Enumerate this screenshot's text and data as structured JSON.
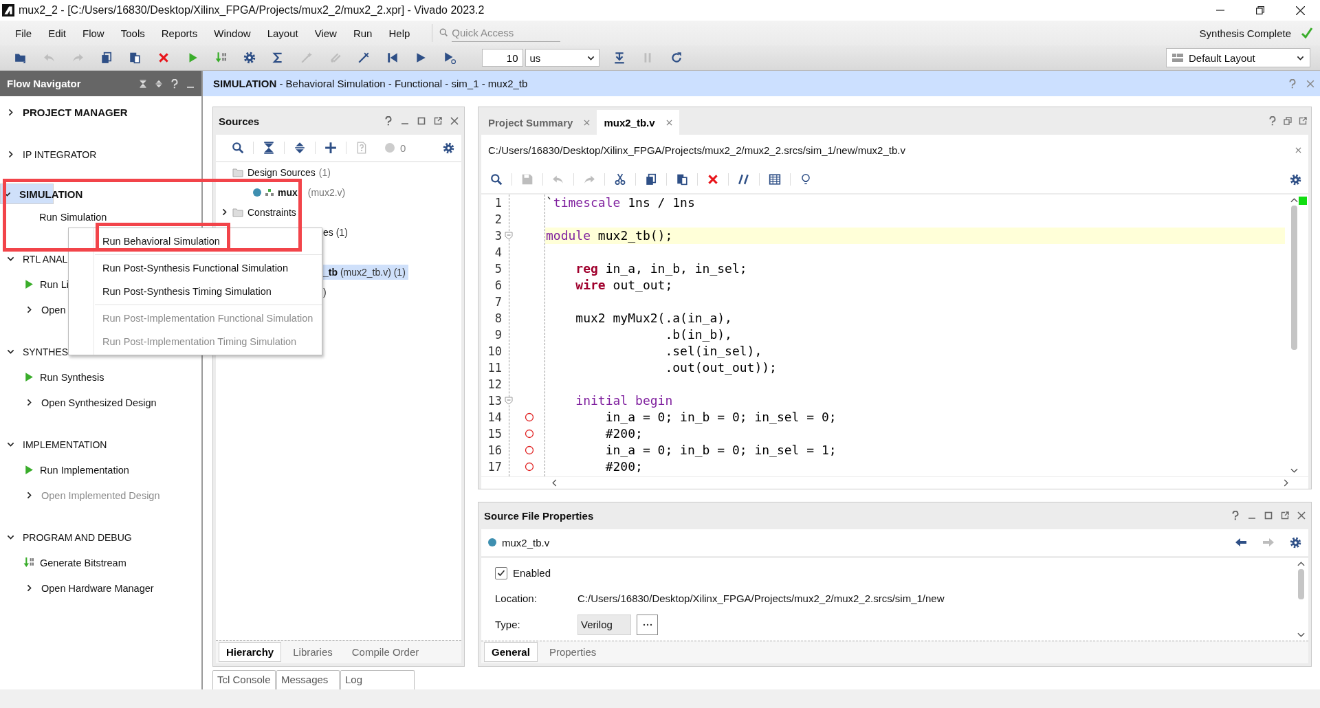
{
  "window": {
    "title": "mux2_2 - [C:/Users/16830/Desktop/Xilinx_FPGA/Projects/mux2_2/mux2_2.xpr] - Vivado 2023.2"
  },
  "menu": [
    "File",
    "Edit",
    "Flow",
    "Tools",
    "Reports",
    "Window",
    "Layout",
    "View",
    "Run",
    "Help"
  ],
  "quick_access": {
    "placeholder": "Quick Access"
  },
  "status": "Synthesis Complete",
  "toolbar": {
    "buttons_left": [
      {
        "disabled": false
      },
      {
        "disabled": true
      },
      {
        "disabled": true
      },
      {
        "disabled": false
      },
      {
        "disabled": false
      },
      {
        "disabled": false
      },
      {
        "disabled": false
      },
      {
        "disabled": false
      },
      {
        "disabled": false
      },
      {
        "disabled": false
      },
      {
        "disabled": true
      },
      {
        "disabled": true
      },
      {
        "disabled": false
      },
      {
        "disabled": false
      },
      {
        "disabled": false
      },
      {
        "disabled": false
      }
    ],
    "time_value": "10",
    "time_unit": "us",
    "buttons_right": [
      {
        "disabled": false
      },
      {
        "disabled": true
      },
      {
        "disabled": false
      }
    ]
  },
  "layout_selector": "Default Layout",
  "flow_navigator": {
    "title": "Flow Navigator",
    "sections": [
      {
        "title": "PROJECT MANAGER",
        "expanded": false,
        "emphasized": true,
        "selected": false
      },
      {
        "title": "IP INTEGRATOR",
        "expanded": false,
        "emphasized": false,
        "selected": false
      },
      {
        "title": "SIMULATION",
        "expanded": true,
        "emphasized": true,
        "selected": true,
        "items": [
          {
            "label": "Run Simulation",
            "kind": "plain",
            "disabled": false
          }
        ]
      },
      {
        "title": "RTL ANAL",
        "expanded": true,
        "emphasized": false,
        "selected": false,
        "items": [
          {
            "label": "Run Li",
            "kind": "run",
            "disabled": false
          },
          {
            "label": "Open",
            "kind": "open",
            "disabled": false
          }
        ]
      },
      {
        "title": "SYNTHES",
        "expanded": true,
        "emphasized": false,
        "selected": false,
        "items": [
          {
            "label": "Run Synthesis",
            "kind": "run",
            "disabled": false
          },
          {
            "label": "Open Synthesized Design",
            "kind": "open",
            "disabled": false
          }
        ]
      },
      {
        "title": "IMPLEMENTATION",
        "expanded": true,
        "emphasized": false,
        "selected": false,
        "items": [
          {
            "label": "Run Implementation",
            "kind": "run",
            "disabled": false
          },
          {
            "label": "Open Implemented Design",
            "kind": "open",
            "disabled": true
          }
        ]
      },
      {
        "title": "PROGRAM AND DEBUG",
        "expanded": true,
        "emphasized": false,
        "selected": false,
        "items": [
          {
            "label": "Generate Bitstream",
            "kind": "bitstream",
            "disabled": false
          },
          {
            "label": "Open Hardware Manager",
            "kind": "open",
            "disabled": false
          }
        ]
      }
    ]
  },
  "banner": "**SIMULATION** - Behavioral Simulation - Functional - sim_1 - mux2_tb",
  "context_menu": {
    "groups": [
      {
        "items": [
          {
            "label": "Run Behavioral Simulation",
            "disabled": false
          }
        ]
      },
      {
        "items": [
          {
            "label": "Run Post-Synthesis Functional Simulation",
            "disabled": false
          },
          {
            "label": "Run Post-Synthesis Timing Simulation",
            "disabled": false
          }
        ]
      },
      {
        "items": [
          {
            "label": "Run Post-Implementation Functional Simulation",
            "disabled": true
          },
          {
            "label": "Run Post-Implementation Timing Simulation",
            "disabled": true
          }
        ]
      }
    ]
  },
  "sources": {
    "title": "Sources",
    "toolbar": [
      {
        "disabled": false
      },
      {
        "disabled": false
      },
      {
        "disabled": false
      },
      {
        "disabled": false
      },
      {
        "disabled": true
      }
    ],
    "issue_count": "0",
    "tree": [
      {
        "label": "Design Sources",
        "count": "(1)",
        "kind": "folder",
        "selected": false,
        "children": [
          {
            "label": "mux",
            "count": "(mux2.v)",
            "kind": "file",
            "selected": false
          }
        ]
      },
      {
        "label": "Constraints",
        "kind": "folder",
        "expanded": false,
        "selected": false
      }
    ],
    "rows_beside_menu": [
      {
        "label": "es",
        "count": "(1)",
        "kind": "folder",
        "selected": false
      },
      {
        "label": "_tb",
        "count": "(mux2_tb.v) (1)",
        "kind": "file",
        "selected": true
      },
      {
        "count": ")",
        "selected": false
      }
    ],
    "tabs": [
      {
        "label": "Hierarchy",
        "selected": true
      },
      {
        "label": "Libraries",
        "selected": false
      },
      {
        "label": "Compile Order",
        "selected": false
      }
    ]
  },
  "console_tabs": [
    "Tcl Console",
    "Messages",
    "Log"
  ],
  "editor": {
    "tabs": [
      {
        "label": "Project Summary",
        "selected": false
      },
      {
        "label": "mux2_tb.v",
        "selected": true
      }
    ],
    "path": "C:/Users/16830/Desktop/Xilinx_FPGA/Projects/mux2_2/mux2_2.srcs/sim_1/new/mux2_tb.v",
    "toolbar": [
      {
        "disabled": false
      },
      {
        "disabled": true
      },
      {
        "disabled": true
      },
      {
        "disabled": true
      },
      {
        "disabled": false
      },
      {
        "disabled": false
      },
      {
        "disabled": false
      },
      {
        "disabled": false
      },
      {
        "disabled": false
      },
      {
        "disabled": false
      },
      {
        "disabled": false
      }
    ],
    "lines": [
      {
        "n": "1",
        "fold": false,
        "breakpoint": false,
        "current": false,
        "tokens": [
          {
            "text": "`",
            "kind": "plain"
          },
          {
            "text": "timescale",
            "kind": "keyword"
          },
          {
            "text": " 1ns / 1ns",
            "kind": "plain"
          }
        ]
      },
      {
        "n": "2",
        "fold": false,
        "breakpoint": false,
        "current": false
      },
      {
        "n": "3",
        "fold": true,
        "breakpoint": false,
        "current": true,
        "tokens": [
          {
            "text": "module",
            "kind": "keyword"
          },
          {
            "text": " mux2_tb();",
            "kind": "plain"
          }
        ]
      },
      {
        "n": "4",
        "fold": false,
        "breakpoint": false,
        "current": false
      },
      {
        "n": "5",
        "fold": false,
        "breakpoint": false,
        "current": false,
        "tokens": [
          {
            "text": "    reg",
            "kind": "type"
          },
          {
            "text": " in_a, in_b, in_sel;",
            "kind": "plain"
          }
        ]
      },
      {
        "n": "6",
        "fold": false,
        "breakpoint": false,
        "current": false,
        "tokens": [
          {
            "text": "    wire",
            "kind": "type"
          },
          {
            "text": " out_out;",
            "kind": "plain"
          }
        ]
      },
      {
        "n": "7",
        "fold": false,
        "breakpoint": false,
        "current": false
      },
      {
        "n": "8",
        "fold": false,
        "breakpoint": false,
        "current": false,
        "tokens": [
          {
            "text": "    mux2 myMux2(.a(in_a),",
            "kind": "plain"
          }
        ]
      },
      {
        "n": "9",
        "fold": false,
        "breakpoint": false,
        "current": false,
        "tokens": [
          {
            "text": "                .b(in_b),",
            "kind": "plain"
          }
        ]
      },
      {
        "n": "10",
        "fold": false,
        "breakpoint": false,
        "current": false,
        "tokens": [
          {
            "text": "                .sel(in_sel),",
            "kind": "plain"
          }
        ]
      },
      {
        "n": "11",
        "fold": false,
        "breakpoint": false,
        "current": false,
        "tokens": [
          {
            "text": "                .out(out_out));",
            "kind": "plain"
          }
        ]
      },
      {
        "n": "12",
        "fold": false,
        "breakpoint": false,
        "current": false
      },
      {
        "n": "13",
        "fold": true,
        "breakpoint": false,
        "current": false,
        "tokens": [
          {
            "text": "    initial begin",
            "kind": "keyword"
          }
        ]
      },
      {
        "n": "14",
        "fold": false,
        "breakpoint": true,
        "current": false,
        "tokens": [
          {
            "text": "        in_a = 0; in_b = 0; in_sel = 0;",
            "kind": "plain"
          }
        ]
      },
      {
        "n": "15",
        "fold": false,
        "breakpoint": true,
        "current": false,
        "tokens": [
          {
            "text": "        #200;",
            "kind": "plain"
          }
        ]
      },
      {
        "n": "16",
        "fold": false,
        "breakpoint": true,
        "current": false,
        "tokens": [
          {
            "text": "        in_a = 0; in_b = 0; in_sel = 1;",
            "kind": "plain"
          }
        ]
      },
      {
        "n": "17",
        "fold": false,
        "breakpoint": true,
        "current": false,
        "tokens": [
          {
            "text": "        #200;",
            "kind": "plain"
          }
        ]
      }
    ]
  },
  "properties": {
    "title": "Source File Properties",
    "file": "mux2_tb.v",
    "history": [
      {
        "disabled": false
      },
      {
        "disabled": true
      }
    ],
    "enabled": {
      "label": "Enabled",
      "checked": true
    },
    "fields": [
      {
        "label": "Location:",
        "value": "C:/Users/16830/Desktop/Xilinx_FPGA/Projects/mux2_2/mux2_2.srcs/sim_1/new",
        "kind": "text"
      },
      {
        "label": "Type:",
        "value": "Verilog",
        "kind": "select"
      }
    ],
    "tabs": [
      {
        "label": "General",
        "selected": true
      },
      {
        "label": "Properties",
        "selected": false
      }
    ]
  }
}
